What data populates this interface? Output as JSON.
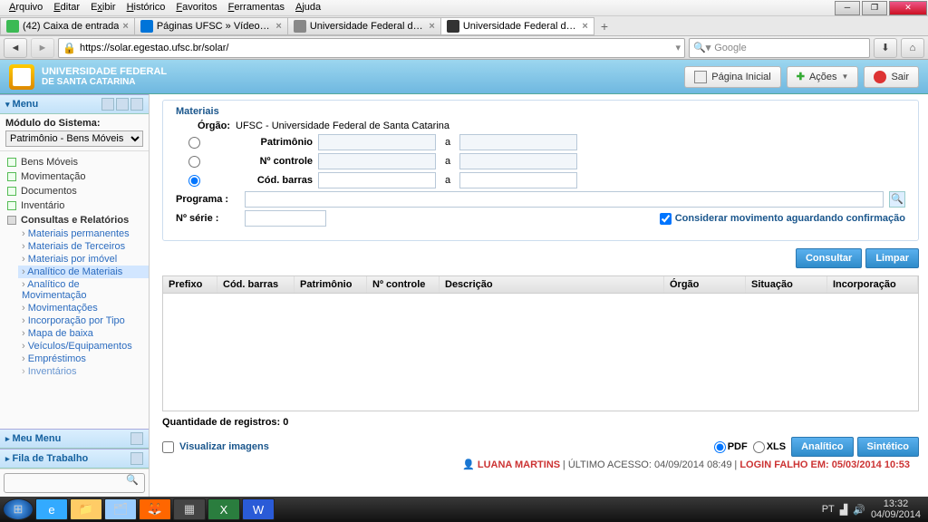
{
  "menubar": {
    "items": [
      "Arquivo",
      "Editar",
      "Exibir",
      "Histórico",
      "Favoritos",
      "Ferramentas",
      "Ajuda"
    ]
  },
  "tabs": [
    {
      "title": "(42) Caixa de entrada",
      "fav": "#3cba54"
    },
    {
      "title": "Páginas UFSC » Vídeo-tuto...",
      "fav": "#0074d9"
    },
    {
      "title": "Universidade Federal de Sa...",
      "fav": "#888"
    },
    {
      "title": "Universidade Federal de Sa...",
      "fav": "#333",
      "active": true
    }
  ],
  "url": "https://solar.egestao.ufsc.br/solar/",
  "searchplaceholder": "Google",
  "brand": {
    "line1": "UNIVERSIDADE FEDERAL",
    "line2": "DE SANTA CATARINA"
  },
  "appbtns": {
    "home": "Página Inicial",
    "acoes": "Ações",
    "sair": "Sair"
  },
  "left": {
    "menu": "Menu",
    "modlabel": "Módulo do Sistema:",
    "modvalue": "Patrimônio - Bens Móveis",
    "items": [
      "Bens Móveis",
      "Movimentação",
      "Documentos",
      "Inventário"
    ],
    "reports": "Consultas e Relatórios",
    "subs": [
      "Materiais permanentes",
      "Materiais de Terceiros",
      "Materiais por imóvel",
      "Analítico de Materiais",
      "Analítico de Movimentação",
      "Movimentações",
      "Incorporação por Tipo",
      "Mapa de baixa",
      "Veículos/Equipamentos",
      "Empréstimos",
      "Inventários"
    ],
    "selected": 3,
    "meumenu": "Meu Menu",
    "fila": "Fila de Trabalho"
  },
  "form": {
    "materiais": "Materiais",
    "orgaolbl": "Órgão:",
    "orgaoval": "UFSC - Universidade Federal de Santa Catarina",
    "patrimonio": "Patrimônio",
    "ncontrole": "Nº controle",
    "codbarras": "Cód. barras",
    "a": "a",
    "programa": "Programa :",
    "nserie": "Nº série :",
    "considerar": "Considerar movimento aguardando confirmação"
  },
  "btns": {
    "consultar": "Consultar",
    "limpar": "Limpar",
    "analitico": "Analítico",
    "sintetico": "Sintético"
  },
  "gridcols": [
    "Prefixo",
    "Cód. barras",
    "Patrimônio",
    "Nº controle",
    "Descrição",
    "Órgão",
    "Situação",
    "Incorporação"
  ],
  "qtd": "Quantidade de registros: 0",
  "vimg": "Visualizar imagens",
  "fmt": {
    "pdf": "PDF",
    "xls": "XLS"
  },
  "status": {
    "user": "LUANA MARTINS",
    "sep": "|",
    "acesso": "ÚLTIMO ACESSO: 04/09/2014 08:49",
    "falho": "LOGIN FALHO EM: 05/03/2014 10:53"
  },
  "tray": {
    "lang": "PT",
    "time": "13:32",
    "date": "04/09/2014"
  }
}
